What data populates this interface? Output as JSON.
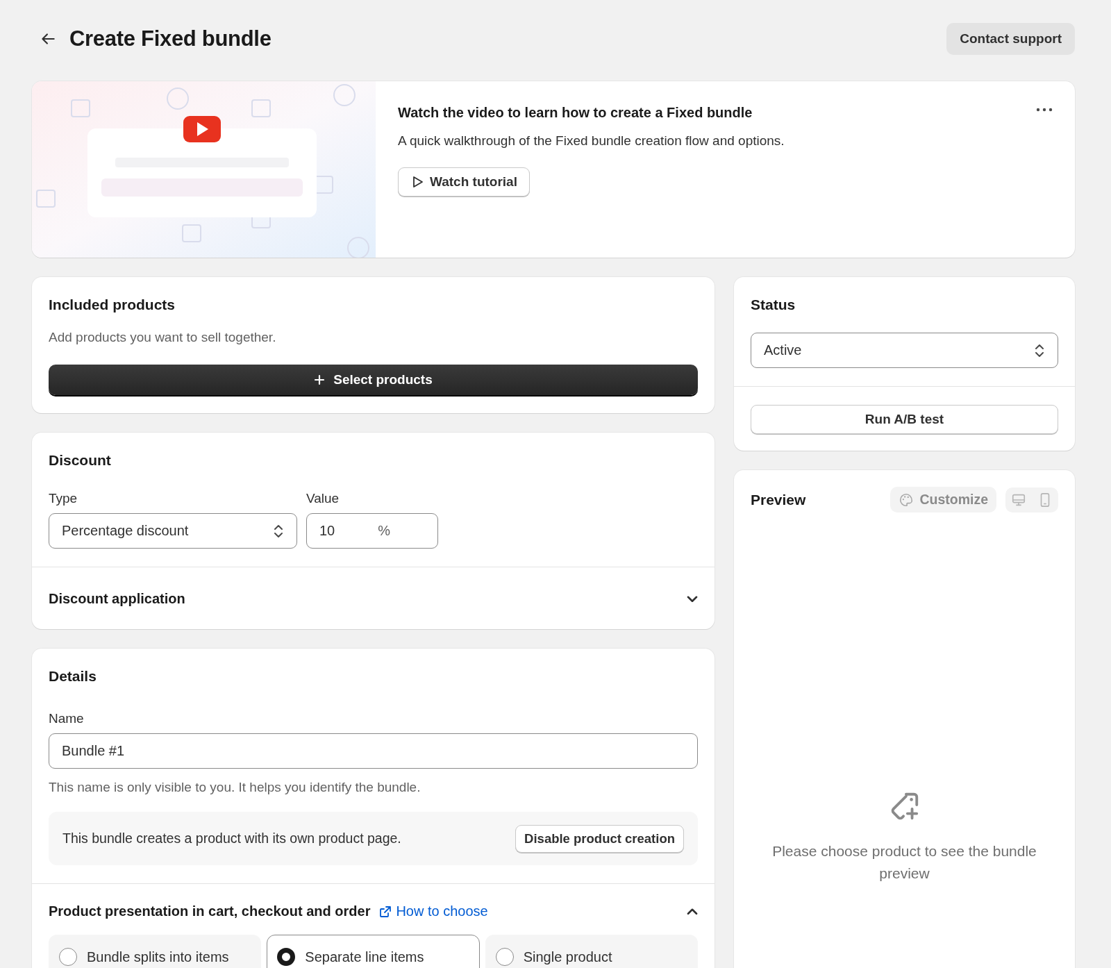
{
  "header": {
    "title": "Create Fixed bundle",
    "support_button": "Contact support"
  },
  "video_card": {
    "title": "Watch the video to learn how to create a Fixed bundle",
    "description": "A quick walkthrough of the Fixed bundle creation flow and options.",
    "button": "Watch tutorial"
  },
  "included_products": {
    "title": "Included products",
    "description": "Add products you want to sell together.",
    "button": "Select products"
  },
  "discount": {
    "title": "Discount",
    "type": {
      "label": "Type",
      "value": "Percentage discount"
    },
    "value": {
      "label": "Value",
      "value": "10",
      "suffix": "%"
    },
    "application": {
      "title": "Discount application",
      "expanded": false
    }
  },
  "details": {
    "title": "Details",
    "name": {
      "label": "Name",
      "value": "Bundle #1",
      "help": "This name is only visible to you. It helps you identify the bundle."
    },
    "product_creation": {
      "text": "This bundle creates a product with its own product page.",
      "button": "Disable product creation"
    },
    "presentation": {
      "title": "Product presentation in cart, checkout and order",
      "link": "How to choose",
      "expanded": true,
      "options": [
        {
          "label": "Bundle splits into items",
          "selected": false
        },
        {
          "label": "Separate line items",
          "selected": true
        },
        {
          "label": "Single product",
          "selected": false
        }
      ]
    }
  },
  "status": {
    "title": "Status",
    "select": "Active",
    "ab_button": "Run A/B test"
  },
  "preview": {
    "title": "Preview",
    "customize": "Customize",
    "empty_text": "Please choose product to see the bundle preview"
  }
}
